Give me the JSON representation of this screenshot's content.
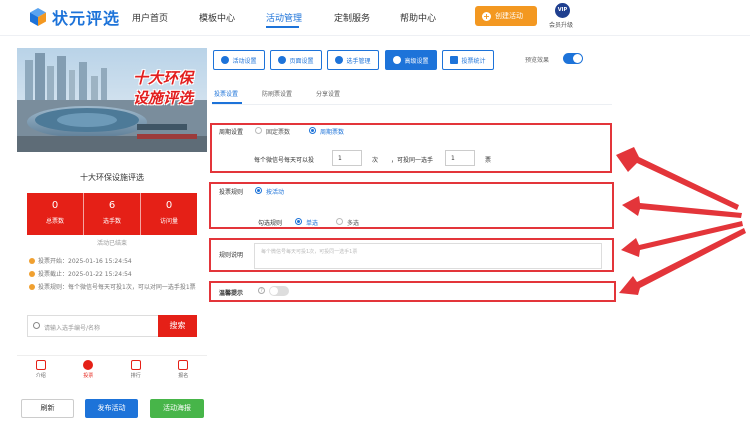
{
  "brand": {
    "name": "状元评选",
    "color": "#1d73d9"
  },
  "nav": {
    "items": [
      "用户首页",
      "模板中心",
      "活动管理",
      "定制服务",
      "帮助中心"
    ],
    "active_index": 2,
    "create_button": "创建活动",
    "vip_badge": "VIP",
    "vip_label": "会员升级"
  },
  "preview": {
    "banner_title_line1": "十大环保",
    "banner_title_line2": "设施评选",
    "activity_title": "十大环保设施评选",
    "stats": [
      {
        "value": "0",
        "label": "总票数"
      },
      {
        "value": "6",
        "label": "选手数"
      },
      {
        "value": "0",
        "label": "访问量"
      }
    ],
    "status": "活动已结束",
    "info": [
      "投票开始：2025-01-16 15:24:54",
      "投票截止：2025-01-22 15:24:54",
      "投票规则：每个微信号每天可投1次，可以对同一选手投1票"
    ],
    "search_placeholder": "请输入选手编号/名称",
    "search_button": "搜索",
    "tabs": [
      "介绍",
      "投票",
      "排行",
      "报名"
    ],
    "active_tab": 1
  },
  "actions": {
    "refresh": "刷新",
    "publish": "发布活动",
    "poster": "活动海报"
  },
  "toolbar": {
    "buttons": [
      "活动设置",
      "页面设置",
      "选手管理",
      "高级设置",
      "投票统计"
    ],
    "active_index": 3,
    "preview_label": "预览效果",
    "preview_on": true
  },
  "subtabs": {
    "items": [
      "投票设置",
      "防刷票设置",
      "分享设置"
    ],
    "active_index": 0
  },
  "settings": {
    "cycle_label": "周期设置",
    "cycle_options": [
      "固定票数",
      "周期票数"
    ],
    "cycle_selected": 1,
    "per_day_prefix": "每个微信号每天可以投",
    "per_day_value": "1",
    "per_day_mid": "次",
    "per_player_prefix": "，可投同一选手",
    "per_player_value": "1",
    "per_player_unit": "票",
    "rule_label": "投票规则",
    "rule_option": "按活动",
    "check_label": "勾选规则",
    "check_options": [
      "单选",
      "多选"
    ],
    "check_selected": 0,
    "desc_label": "规则说明",
    "desc_placeholder": "每个微信号每天可投1次，可投同一选手1票",
    "tip_label": "温馨提示",
    "tip_help": "?",
    "tip_on": false
  }
}
